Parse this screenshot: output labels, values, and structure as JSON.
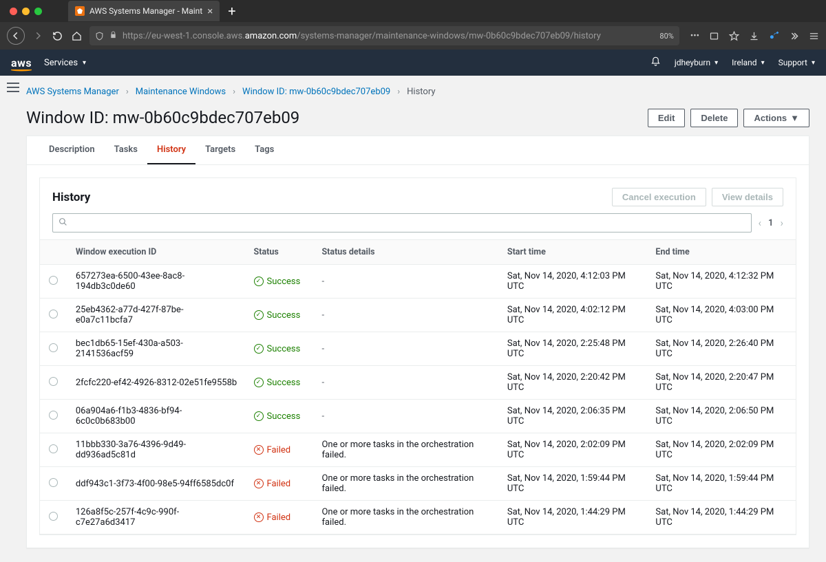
{
  "browser": {
    "tab_title": "AWS Systems Manager - Maint",
    "url_prefix": "https://eu-west-1.console.aws.",
    "url_host": "amazon.com",
    "url_path": "/systems-manager/maintenance-windows/mw-0b60c9bdec707eb09/history",
    "zoom": "80%"
  },
  "aws_header": {
    "logo": "aws",
    "services": "Services",
    "user": "jdheyburn",
    "region": "Ireland",
    "support": "Support"
  },
  "breadcrumb": {
    "items": [
      "AWS Systems Manager",
      "Maintenance Windows",
      "Window ID: mw-0b60c9bdec707eb09"
    ],
    "current": "History"
  },
  "page_title": "Window ID: mw-0b60c9bdec707eb09",
  "header_buttons": {
    "edit": "Edit",
    "delete": "Delete",
    "actions": "Actions"
  },
  "tabs": [
    "Description",
    "Tasks",
    "History",
    "Targets",
    "Tags"
  ],
  "active_tab": "History",
  "card": {
    "title": "History",
    "cancel": "Cancel execution",
    "view": "View details",
    "page": "1"
  },
  "columns": {
    "exec_id": "Window execution ID",
    "status": "Status",
    "details": "Status details",
    "start": "Start time",
    "end": "End time"
  },
  "status_labels": {
    "success": "Success",
    "failed": "Failed"
  },
  "fail_details": "One or more tasks in the orchestration failed.",
  "rows": [
    {
      "id": "657273ea-6500-43ee-8ac8-194db3c0de60",
      "status": "success",
      "details": "-",
      "start": "Sat, Nov 14, 2020, 4:12:03 PM UTC",
      "end": "Sat, Nov 14, 2020, 4:12:32 PM UTC"
    },
    {
      "id": "25eb4362-a77d-427f-87be-e0a7c11bcfa7",
      "status": "success",
      "details": "-",
      "start": "Sat, Nov 14, 2020, 4:02:12 PM UTC",
      "end": "Sat, Nov 14, 2020, 4:03:00 PM UTC"
    },
    {
      "id": "bec1db65-15ef-430a-a503-2141536acf59",
      "status": "success",
      "details": "-",
      "start": "Sat, Nov 14, 2020, 2:25:48 PM UTC",
      "end": "Sat, Nov 14, 2020, 2:26:40 PM UTC"
    },
    {
      "id": "2fcfc220-ef42-4926-8312-02e51fe9558b",
      "status": "success",
      "details": "-",
      "start": "Sat, Nov 14, 2020, 2:20:42 PM UTC",
      "end": "Sat, Nov 14, 2020, 2:20:47 PM UTC"
    },
    {
      "id": "06a904a6-f1b3-4836-bf94-6c0c0b683b00",
      "status": "success",
      "details": "-",
      "start": "Sat, Nov 14, 2020, 2:06:35 PM UTC",
      "end": "Sat, Nov 14, 2020, 2:06:50 PM UTC"
    },
    {
      "id": "11bbb330-3a76-4396-9d49-dd936ad5c81d",
      "status": "failed",
      "details": "One or more tasks in the orchestration failed.",
      "start": "Sat, Nov 14, 2020, 2:02:09 PM UTC",
      "end": "Sat, Nov 14, 2020, 2:02:09 PM UTC"
    },
    {
      "id": "ddf943c1-3f73-4f00-98e5-94ff6585dc0f",
      "status": "failed",
      "details": "One or more tasks in the orchestration failed.",
      "start": "Sat, Nov 14, 2020, 1:59:44 PM UTC",
      "end": "Sat, Nov 14, 2020, 1:59:44 PM UTC"
    },
    {
      "id": "126a8f5c-257f-4c9c-990f-c7e27a6d3417",
      "status": "failed",
      "details": "One or more tasks in the orchestration failed.",
      "start": "Sat, Nov 14, 2020, 1:44:29 PM UTC",
      "end": "Sat, Nov 14, 2020, 1:44:29 PM UTC"
    }
  ]
}
